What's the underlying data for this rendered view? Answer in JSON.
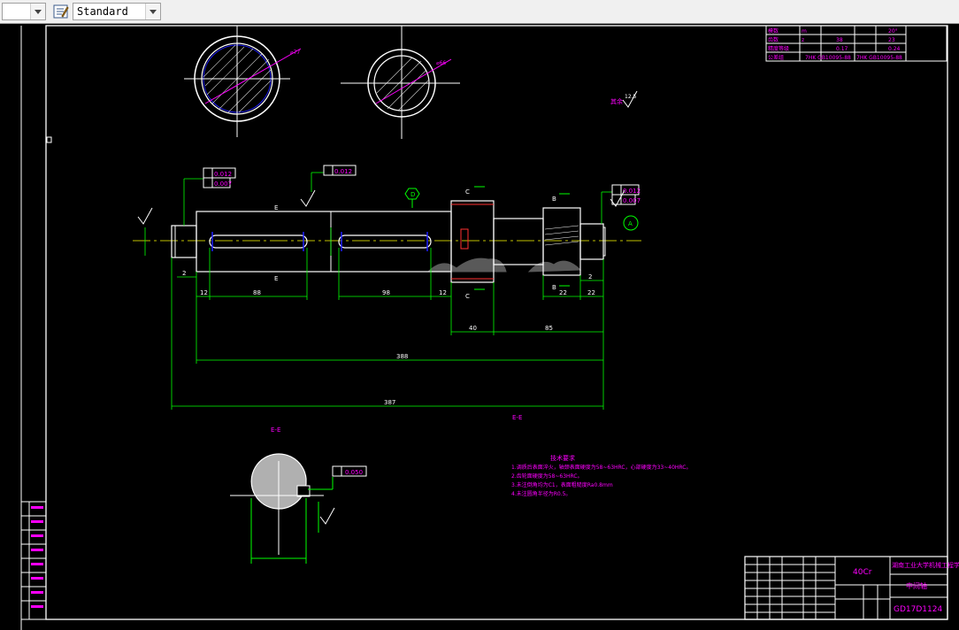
{
  "toolbar": {
    "left_dropdown_value": "",
    "style_dropdown_value": "Standard",
    "icons": [
      "text-style-icon"
    ]
  },
  "drawing": {
    "section_label_top": "E-E",
    "section_label_left": "E-E",
    "material": "40Cr",
    "part_name": "中间轴",
    "drawing_number": "GD17D1124",
    "org_name": "湖南工业大学机械工程学院",
    "dimensions": {
      "d1": "88",
      "d2": "98",
      "len1": "12",
      "len2": "12",
      "len3": "2",
      "len4": "2",
      "len5": "40",
      "len6": "85",
      "len7": "22",
      "len8": "22",
      "overall1": "388",
      "overall2": "387"
    },
    "tolerances": {
      "t1": "0.012",
      "t2": "0.007",
      "t3": "0.012",
      "t4": "0.012",
      "t5": "0.007",
      "t6": "0.050"
    },
    "datums": {
      "a": "A",
      "d": "D",
      "b": "B",
      "c": "C",
      "e": "E"
    },
    "notes_title": "技术要求",
    "notes": [
      "1.调质后表面淬火，轴颈表面硬度为58~63HRC，心部硬度为33~40HRC。",
      "2.齿轮面硬度为58~63HRC。",
      "3.未注倒角均为C1，表面粗糙度Ra0.8mm",
      "4.未注圆角半径为R0.5。"
    ],
    "param_table": {
      "rows": [
        [
          "模数",
          "m",
          "",
          "3",
          "20°"
        ],
        [
          "齿数",
          "z",
          "",
          "38",
          "23"
        ],
        [
          "精度等级",
          "",
          "",
          "0.17",
          "0.24"
        ],
        [
          "公差组",
          "",
          "",
          "7HK GB10095-88",
          "7HK GB10095-88"
        ]
      ]
    },
    "colors": {
      "white": "#ffffff",
      "green": "#00ff00",
      "magenta": "#ff00ff",
      "blue": "#2020ff",
      "yellow": "#ffff00",
      "cyan": "#00ffff",
      "red": "#ff3030"
    }
  }
}
